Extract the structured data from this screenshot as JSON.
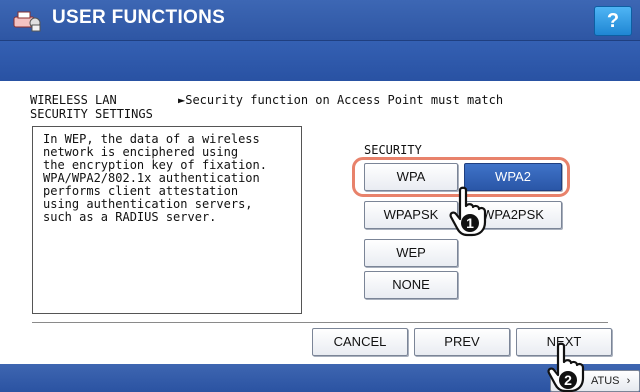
{
  "window": {
    "title": "USER FUNCTIONS",
    "help_label": "?"
  },
  "header": {
    "left_line1": "WIRELESS LAN",
    "left_line2": "SECURITY SETTINGS",
    "right_text": "►Security function on Access Point must match"
  },
  "description": "In WEP, the data of a wireless\nnetwork is enciphered using\nthe encryption key of fixation.\nWPA/WPA2/802.1x authentication\nperforms client attestation\nusing authentication servers,\nsuch as a RADIUS server.",
  "security": {
    "label": "SECURITY",
    "selected": "WPA2",
    "options": [
      "WPA",
      "WPA2",
      "WPAPSK",
      "WPA2PSK",
      "WEP",
      "NONE"
    ]
  },
  "nav": {
    "cancel": "CANCEL",
    "prev": "PREV",
    "next": "NEXT"
  },
  "bottom": {
    "status_label": "ATUS"
  },
  "callouts": {
    "step1": "1",
    "step2": "2"
  },
  "colors": {
    "brand_blue": "#2e56a4",
    "selected_button": "#2a56a7",
    "highlight_ring": "#e8826b"
  },
  "icons": {
    "app": "printer-menu-icon",
    "pointer": "hand-pointer-icon"
  }
}
